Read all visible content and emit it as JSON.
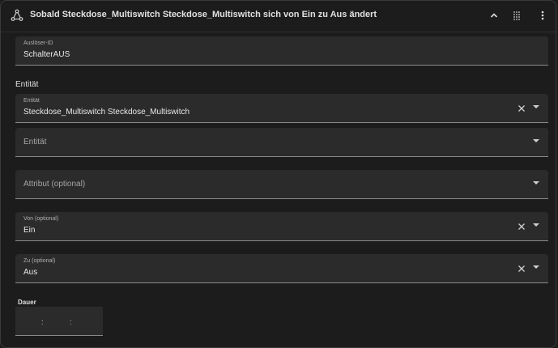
{
  "header": {
    "title": "Sobald Steckdose_Multiswitch Steckdose_Multiswitch sich von Ein zu Aus ändert",
    "icons": [
      "trigger-icon",
      "chevron-up-icon",
      "grid-icon",
      "more-vert-icon"
    ]
  },
  "trigger_id": {
    "label": "Auslöser-ID",
    "value": "SchalterAUS"
  },
  "entity_section": {
    "title": "Entität"
  },
  "entity_field": {
    "label": "Entität",
    "value": "Steckdose_Multiswitch Steckdose_Multiswitch"
  },
  "entity_empty": {
    "placeholder": "Entität"
  },
  "attribute": {
    "placeholder": "Attribut (optional)"
  },
  "from": {
    "label": "Von (optional)",
    "value": "Ein"
  },
  "to": {
    "label": "Zu (optional)",
    "value": "Aus"
  },
  "duration": {
    "label": "Dauer",
    "separator": ":"
  }
}
